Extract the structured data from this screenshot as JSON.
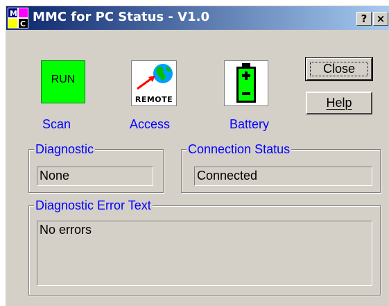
{
  "window": {
    "title": "MMC for PC Status - V1.0",
    "app_icon_letters": "MC",
    "titlebar_buttons": {
      "help": "?",
      "close": "×"
    },
    "colors": {
      "titlebar_start": "#0a246a",
      "titlebar_end": "#a6caf0",
      "face": "#d4d0c8",
      "label_blue": "#0000ff"
    }
  },
  "status_tiles": {
    "scan": {
      "icon": "run-indicator",
      "text": "RUN",
      "caption": "Scan",
      "color": "#00ff00"
    },
    "access": {
      "icon": "remote-globe-icon",
      "text": "REMOTE",
      "caption": "Access"
    },
    "battery": {
      "icon": "battery-icon",
      "caption": "Battery",
      "color": "#00ff00"
    }
  },
  "buttons": {
    "close_label": "Close",
    "help_label": "Help"
  },
  "diagnostic": {
    "label": "Diagnostic",
    "value": "None"
  },
  "connection": {
    "label": "Connection Status",
    "value": "Connected"
  },
  "error_text": {
    "label": "Diagnostic Error Text",
    "value": "No errors"
  }
}
